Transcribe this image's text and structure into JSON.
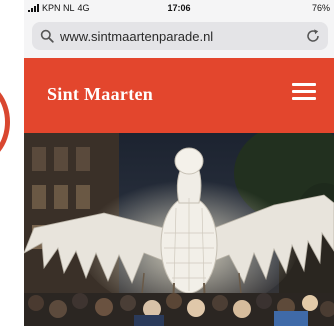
{
  "status_bar": {
    "carrier": "KPN NL",
    "network": "4G",
    "time": "17:06",
    "battery": "76%"
  },
  "browser": {
    "url": "www.sintmaartenparade.nl"
  },
  "site": {
    "title": "Sint Maarten",
    "brand_color": "#e3462d"
  },
  "hero": {
    "image_description_icon": "parade-photo"
  },
  "icons": {
    "search": "search-icon",
    "reload": "reload-icon",
    "menu": "hamburger-menu-icon",
    "signal": "signal-icon"
  }
}
